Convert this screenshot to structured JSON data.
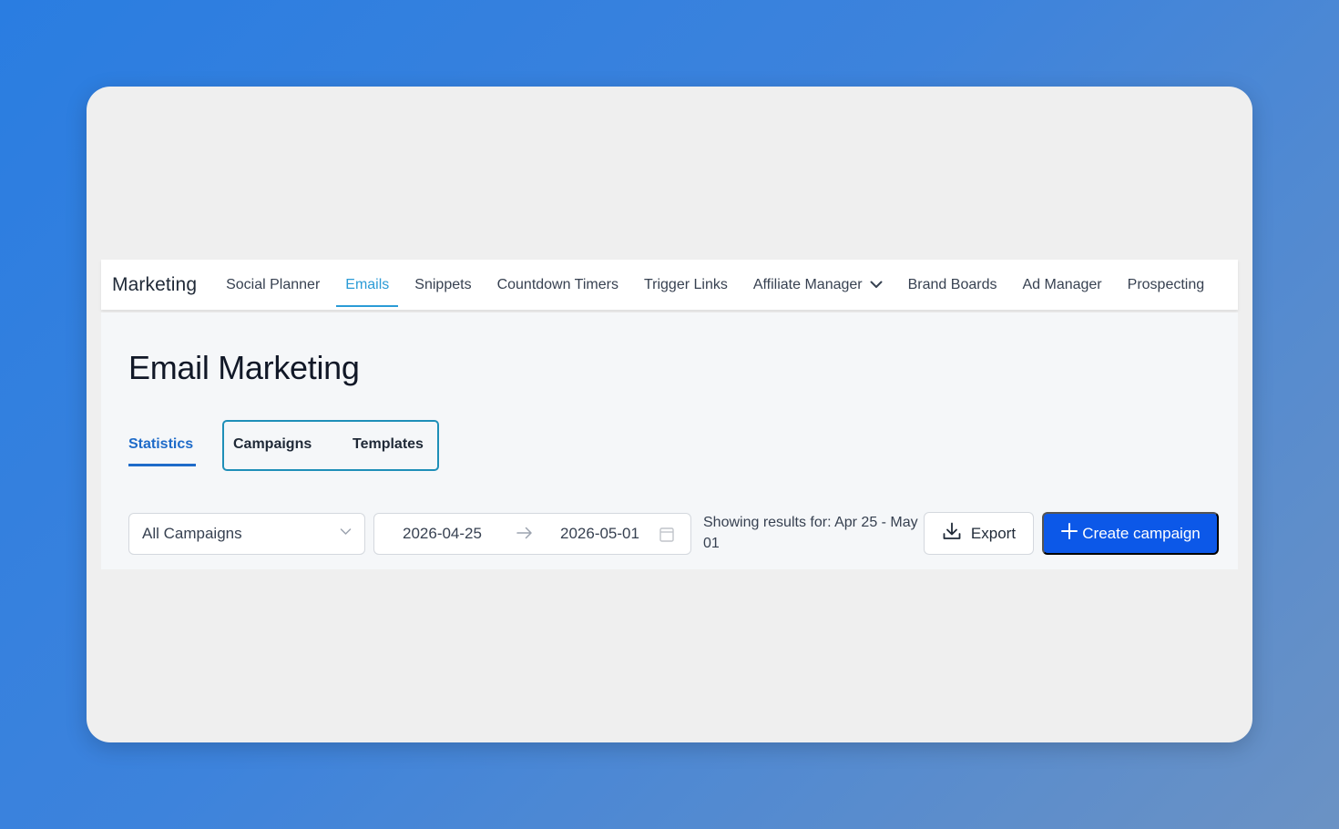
{
  "nav": {
    "brand": "Marketing",
    "items": [
      {
        "label": "Social Planner"
      },
      {
        "label": "Emails",
        "active": true
      },
      {
        "label": "Snippets"
      },
      {
        "label": "Countdown Timers"
      },
      {
        "label": "Trigger Links"
      },
      {
        "label": "Affiliate Manager",
        "icon": "chevron-down-icon"
      },
      {
        "label": "Brand Boards"
      },
      {
        "label": "Ad Manager"
      },
      {
        "label": "Prospecting"
      }
    ]
  },
  "page": {
    "title": "Email Marketing"
  },
  "tabs": {
    "statistics": "Statistics",
    "campaigns": "Campaigns",
    "templates": "Templates",
    "active": "Statistics"
  },
  "filters": {
    "campaign_select": "All Campaigns",
    "date_start": "2026-04-25",
    "date_end": "2026-05-01",
    "showing_text": "Showing results for: Apr 25 - May 01"
  },
  "actions": {
    "export_label": "Export",
    "create_label": "Create campaign"
  },
  "colors": {
    "accent": "#2b9bd6",
    "tab_active": "#1e6bc9",
    "primary_button": "#0c58e8",
    "background_gradient_start": "#2a7de1",
    "background_gradient_end": "#6b92c4"
  }
}
